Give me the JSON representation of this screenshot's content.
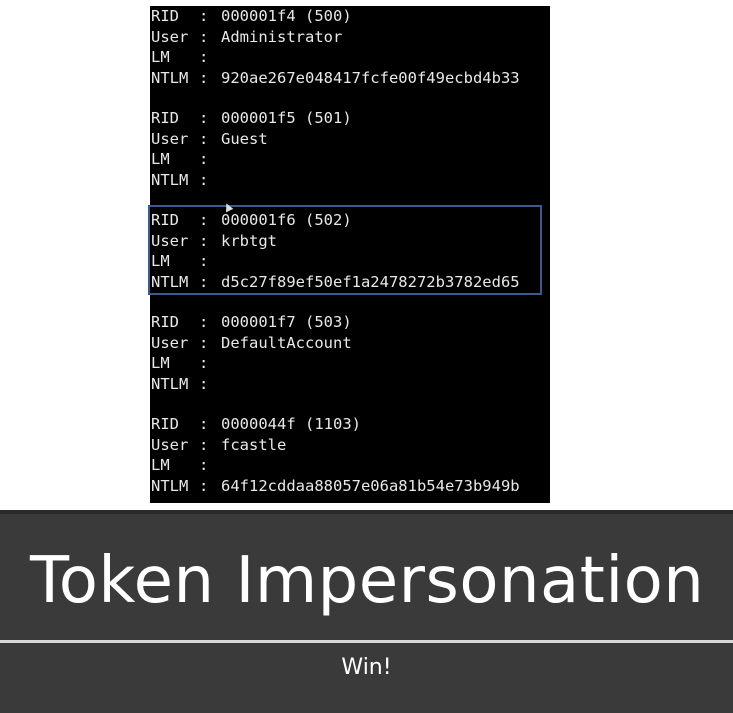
{
  "terminal": {
    "entries": [
      {
        "rid_label": "RID",
        "rid": "000001f4 (500)",
        "user_label": "User",
        "user": "Administrator",
        "lm_label": "LM",
        "lm": "",
        "ntlm_label": "NTLM",
        "ntlm": "920ae267e048417fcfe00f49ecbd4b33"
      },
      {
        "rid_label": "RID",
        "rid": "000001f5 (501)",
        "user_label": "User",
        "user": "Guest",
        "lm_label": "LM",
        "lm": "",
        "ntlm_label": "NTLM",
        "ntlm": ""
      },
      {
        "rid_label": "RID",
        "rid": "000001f6 (502)",
        "user_label": "User",
        "user": "krbtgt",
        "lm_label": "LM",
        "lm": "",
        "ntlm_label": "NTLM",
        "ntlm": "d5c27f89ef50ef1a2478272b3782ed65"
      },
      {
        "rid_label": "RID",
        "rid": "000001f7 (503)",
        "user_label": "User",
        "user": "DefaultAccount",
        "lm_label": "LM",
        "lm": "",
        "ntlm_label": "NTLM",
        "ntlm": ""
      },
      {
        "rid_label": "RID",
        "rid": "0000044f (1103)",
        "user_label": "User",
        "user": "fcastle",
        "lm_label": "LM",
        "lm": "",
        "ntlm_label": "NTLM",
        "ntlm": "64f12cddaa88057e06a81b54e73b949b"
      }
    ],
    "separator": ":",
    "highlight_color": "#3d5a8a"
  },
  "slide": {
    "title": "Token Impersonation",
    "subtitle": "Win!",
    "background": "#3a3a3a",
    "text_color": "#ffffff"
  }
}
